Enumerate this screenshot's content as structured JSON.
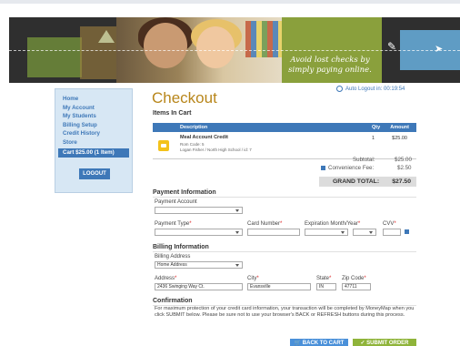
{
  "banner": {
    "slogan": "Avoid lost checks by simply paying online."
  },
  "sidebar": {
    "items": [
      {
        "label": "Home"
      },
      {
        "label": "My Account"
      },
      {
        "label": "My Students"
      },
      {
        "label": "Billing Setup"
      },
      {
        "label": "Credit History"
      },
      {
        "label": "Store"
      }
    ],
    "cart_label": "Cart  $25.00 (1 Item)",
    "logout_label": "LOGOUT"
  },
  "page": {
    "title": "Checkout",
    "auto_logout": "Auto Logout in: 00:19:54"
  },
  "cart": {
    "heading": "Items In Cart",
    "columns": {
      "description": "Description",
      "qty": "Qty",
      "amount": "Amount"
    },
    "items": [
      {
        "name": "Meal Account Credit",
        "sub1": "Rom Code: 5",
        "sub2": "Logan Fisher / North High School / id: 7",
        "qty": "1",
        "amount": "$25.00"
      }
    ],
    "subtotal_label": "Subtotal:",
    "subtotal_value": "$25.00",
    "fee_label": "Convenience Fee:",
    "fee_value": "$2.50",
    "grand_label": "GRAND TOTAL:",
    "grand_value": "$27.50"
  },
  "payment": {
    "heading": "Payment Information",
    "account_label": "Payment Account",
    "account_value": "",
    "type_label": "Payment Type",
    "type_value": "",
    "card_label": "Card Number",
    "card_value": "",
    "exp_label": "Expiration Month/Year",
    "exp_month": "",
    "exp_year": "",
    "cvv_label": "CVV",
    "cvv_value": ""
  },
  "billing": {
    "heading": "Billing Information",
    "address_sel_label": "Billing Address",
    "address_sel_value": "Home Address",
    "address_label": "Address",
    "address_value": "2436 Swinging Way Ct.",
    "city_label": "City",
    "city_value": "Evansville",
    "state_label": "State",
    "state_value": "IN",
    "zip_label": "Zip Code",
    "zip_value": "47711"
  },
  "confirmation": {
    "heading": "Confirmation",
    "text": "For maximum protection of your credit card information, your transaction will be completed by MoneyMap when you click SUBMIT below. Please be sure not to use your browser's BACK or REFRESH buttons during this process."
  },
  "actions": {
    "back_label": "BACK TO CART",
    "submit_label": "SUBMIT ORDER"
  },
  "colors": {
    "accent": "#3e78b8",
    "title": "#b8861b",
    "submit": "#8fb43a"
  }
}
